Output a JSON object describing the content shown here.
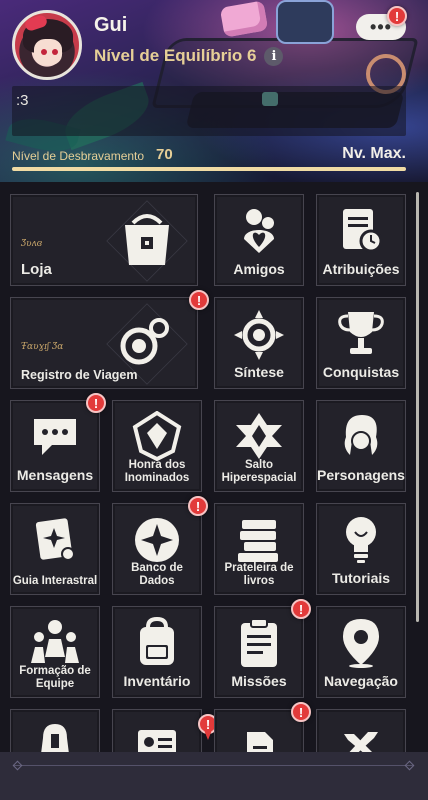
{
  "profile": {
    "name": "Gui",
    "level_label": "Nível de Equilíbrio 6",
    "info_glyph": "i",
    "signature": ":3",
    "more_glyph": "•••",
    "alert_glyph": "!"
  },
  "trailblaze": {
    "label": "Nível de Desbravamento",
    "value": "70",
    "max_label": "Nv. Max.",
    "progress": 1.0
  },
  "tiles": [
    {
      "label": "Loja",
      "sub": "Ʒʋʌɞ",
      "icon": "shop-bag-icon",
      "alert": false
    },
    {
      "label": "Amigos",
      "icon": "friends-icon",
      "alert": false
    },
    {
      "label": "Atribuições",
      "icon": "assignments-icon",
      "alert": false
    },
    {
      "label": "Registro de Viagem",
      "sub": "Ŧɑʋɣɪʃ Ʒɑ",
      "icon": "travel-log-icon",
      "alert": true
    },
    {
      "label": "Síntese",
      "icon": "synthesis-icon",
      "alert": false
    },
    {
      "label": "Conquistas",
      "icon": "trophy-icon",
      "alert": false
    },
    {
      "label": "Mensagens",
      "icon": "messages-icon",
      "alert": true
    },
    {
      "label": "Honra dos Inominados",
      "icon": "nameless-honor-icon",
      "alert": false
    },
    {
      "label": "Salto Hiperespacial",
      "icon": "warp-icon",
      "alert": false
    },
    {
      "label": "Personagens",
      "icon": "characters-icon",
      "alert": false
    },
    {
      "label": "Guia Interastral",
      "icon": "interastral-guide-icon",
      "alert": false
    },
    {
      "label": "Banco de Dados",
      "icon": "databank-icon",
      "alert": true
    },
    {
      "label": "Prateleira de livros",
      "icon": "bookshelf-icon",
      "alert": false
    },
    {
      "label": "Tutoriais",
      "icon": "lightbulb-icon",
      "alert": false
    },
    {
      "label": "Formação de Equipe",
      "icon": "team-setup-icon",
      "alert": false
    },
    {
      "label": "Inventário",
      "icon": "backpack-icon",
      "alert": false
    },
    {
      "label": "Missões",
      "icon": "clipboard-icon",
      "alert": true
    },
    {
      "label": "Navegação",
      "icon": "map-pin-icon",
      "alert": false
    },
    {
      "label": "",
      "icon": "bell-icon",
      "alert": false
    },
    {
      "label": "",
      "icon": "id-card-icon",
      "alert": true
    },
    {
      "label": "",
      "icon": "document-icon",
      "alert": true
    },
    {
      "label": "",
      "icon": "tools-icon",
      "alert": false
    }
  ],
  "colors": {
    "gold": "#e6cf97",
    "tile_bg": "#23222a",
    "alert_red": "#e23a3a"
  }
}
